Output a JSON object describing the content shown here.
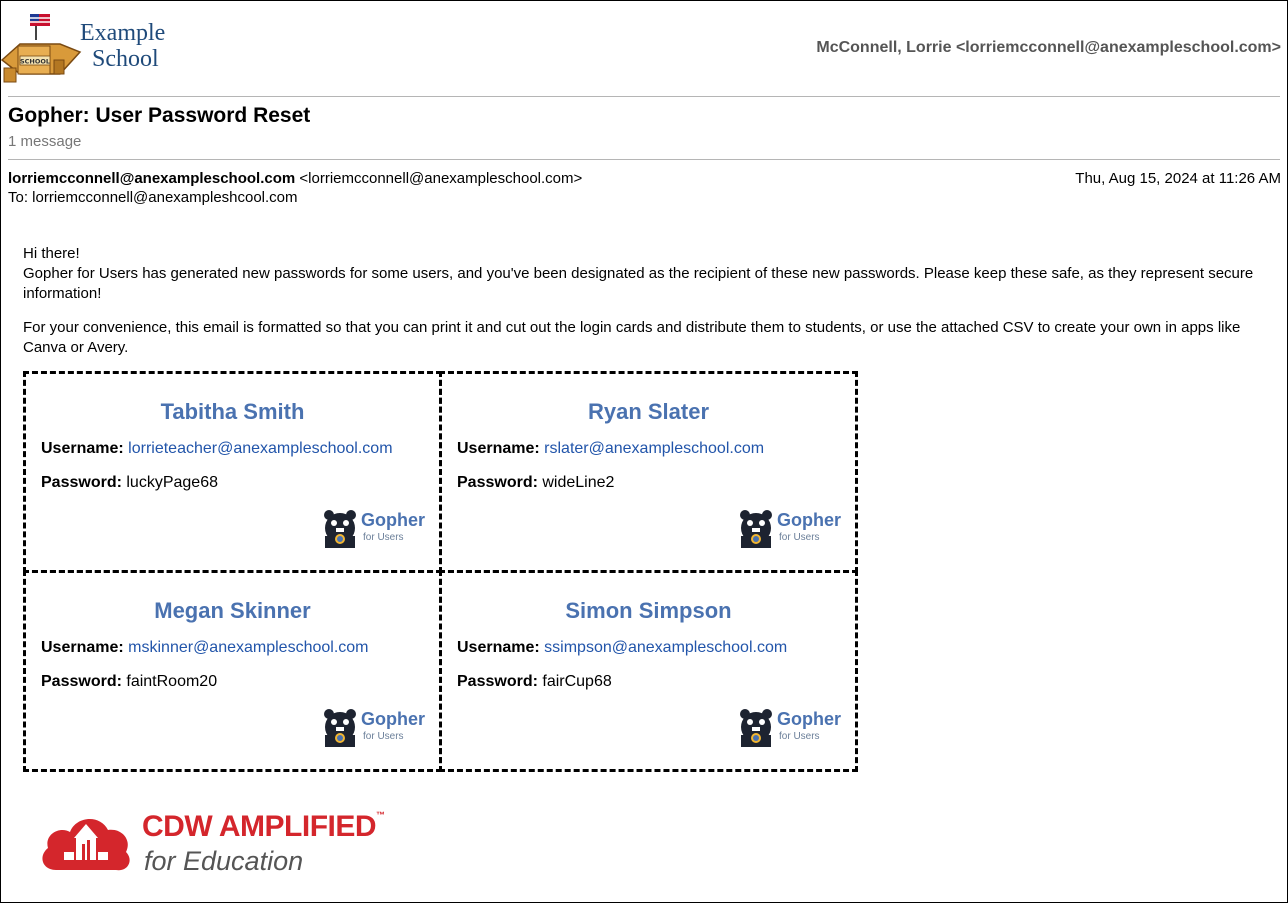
{
  "header": {
    "logo_line1": "Example",
    "logo_line2": "School",
    "logo_building_sign": "SCHOOL",
    "account": "McConnell, Lorrie <lorriemcconnell@anexampleschool.com>"
  },
  "email": {
    "subject": "Gopher: User Password Reset",
    "message_count": "1 message",
    "from_name": "lorriemcconnell@anexampleschool.com",
    "from_address": "<lorriemcconnell@anexampleschool.com>",
    "to": "To: lorriemcconnell@anexampleshcool.com",
    "date": "Thu, Aug 15, 2024 at 11:26 AM",
    "greeting": "Hi there!",
    "para1": "Gopher for Users has generated new passwords for some users, and you've been designated as the recipient of these new passwords. Please keep these safe, as they represent secure information!",
    "para2": "For your convenience, this email is formatted so that you can print it and cut out the login cards and distribute them to students, or use the attached CSV to create your own in apps like Canva or Avery."
  },
  "labels": {
    "username": "Username:",
    "password": "Password:",
    "gopher_brand": "Gopher",
    "gopher_sub": "for Users"
  },
  "cards": [
    {
      "name": "Tabitha Smith",
      "username": "lorrieteacher@anexampleschool.com",
      "password": "luckyPage68"
    },
    {
      "name": "Ryan Slater",
      "username": "rslater@anexampleschool.com",
      "password": "wideLine2"
    },
    {
      "name": "Megan Skinner",
      "username": "mskinner@anexampleschool.com",
      "password": "faintRoom20"
    },
    {
      "name": "Simon Simpson",
      "username": "ssimpson@anexampleschool.com",
      "password": "fairCup68"
    }
  ],
  "footer": {
    "brand_line1": "CDW AMPLIFIED",
    "brand_tm": "™",
    "brand_line2": "for Education"
  },
  "colors": {
    "name_blue": "#4a72b0",
    "link_blue": "#2255aa",
    "cdw_red": "#d4262c"
  }
}
